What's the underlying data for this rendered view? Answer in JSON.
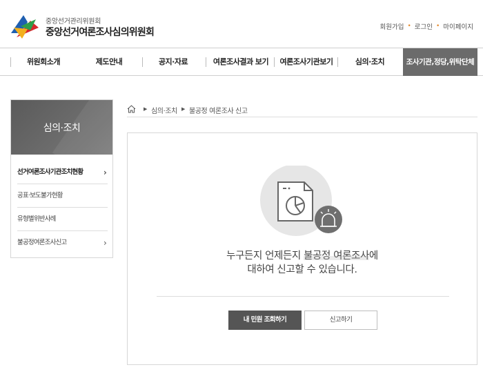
{
  "header": {
    "org_sub": "중앙선거관리위원회",
    "org_main": "중앙선거여론조사심의위원회",
    "util_links": [
      "회원가입",
      "로그인",
      "마이페이지"
    ]
  },
  "gnb": {
    "items": [
      "위원회소개",
      "제도안내",
      "공지·자료",
      "여론조사결과 보기",
      "여론조사기관보기",
      "심의·조치",
      "조사기관,정당,위탁단체"
    ]
  },
  "lnb": {
    "title": "심의·조치",
    "items": [
      {
        "label": "선거여론조사기관조치현황",
        "has_arrow": true
      },
      {
        "label": "공표·보도불가현황",
        "has_arrow": false
      },
      {
        "label": "유형별위반사례",
        "has_arrow": false
      },
      {
        "label": "불공정여론조사신고",
        "has_arrow": true
      }
    ]
  },
  "breadcrumb": {
    "items": [
      "심의·조치",
      "불공정 여론조사 신고"
    ]
  },
  "content": {
    "line1_before": "누구든지 언제든지 ",
    "line1_highlight": "불공정 여론조사",
    "line1_after": "에",
    "line2": "대하여 신고할 수 있습니다.",
    "btn_lookup": "내 민원 조회하기",
    "btn_report": "신고하기"
  },
  "icons": {
    "logo": "election-commission-logo",
    "home": "home-icon",
    "illustration": "report-document-siren-icon"
  },
  "colors": {
    "active_menu": "#6b6b6b",
    "accent_dot": "#e58a2c",
    "dark_button": "#555555"
  }
}
